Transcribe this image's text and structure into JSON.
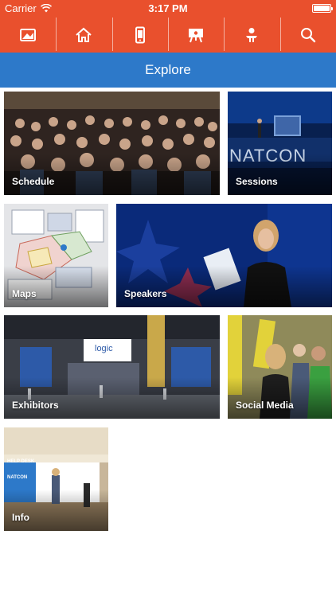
{
  "status_bar": {
    "carrier": "Carrier",
    "time": "3:17 PM"
  },
  "toolbar": {
    "icons": [
      "map-book-icon",
      "home-icon",
      "mobile-icon",
      "presentation-icon",
      "speaker-icon",
      "search-icon"
    ]
  },
  "header": {
    "title": "Explore"
  },
  "tiles": {
    "schedule": {
      "label": "Schedule"
    },
    "sessions": {
      "label": "Sessions",
      "screen_text": "NATCON"
    },
    "maps": {
      "label": "Maps"
    },
    "speakers": {
      "label": "Speakers"
    },
    "exhibitors": {
      "label": "Exhibitors",
      "banner_text": "logic"
    },
    "social_media": {
      "label": "Social Media"
    },
    "info": {
      "label": "Info",
      "sign_text": "HELP DESK",
      "counter_text": "NATCON"
    }
  },
  "colors": {
    "brand_orange": "#e9502d",
    "header_blue": "#2d79c9",
    "background": "#ffffff"
  }
}
